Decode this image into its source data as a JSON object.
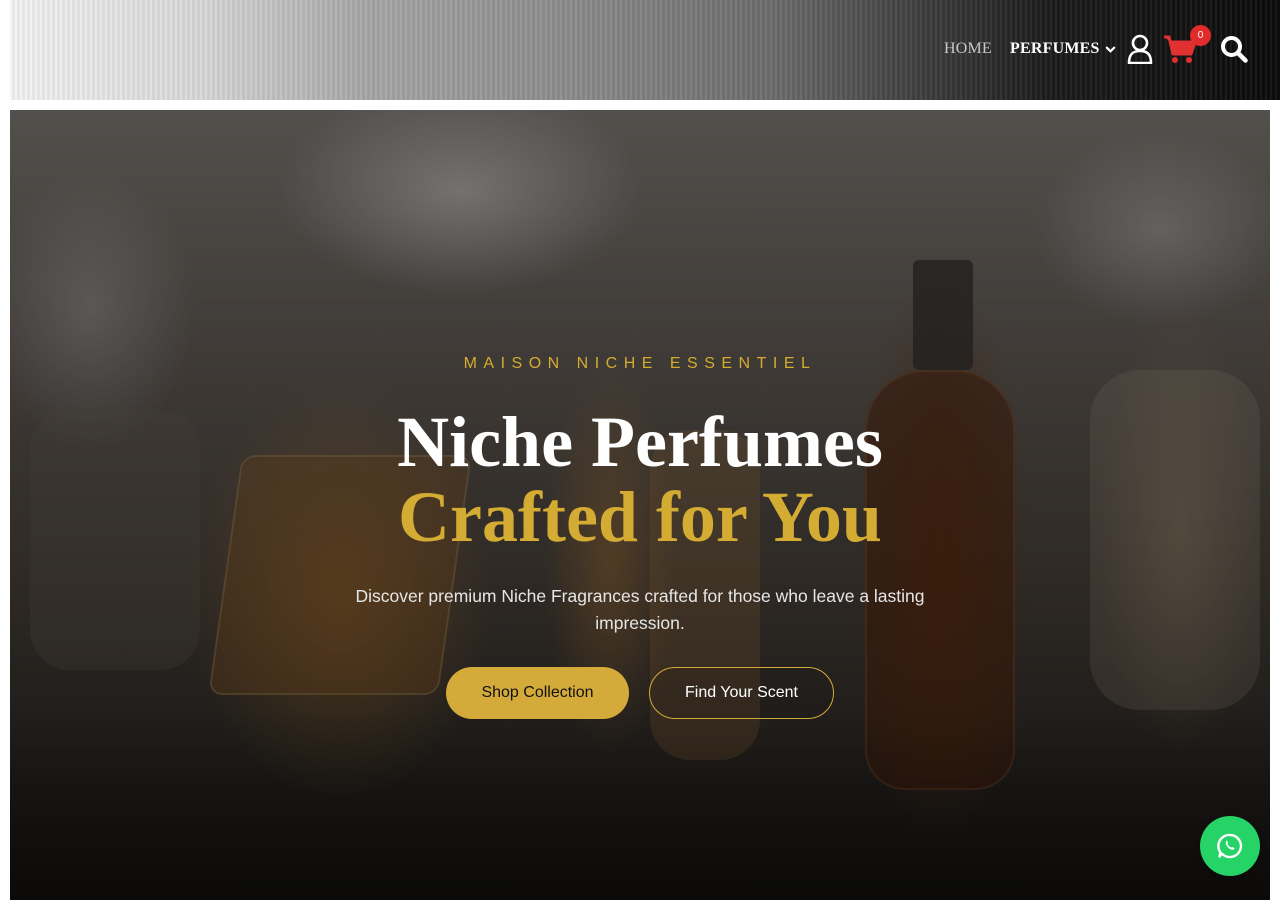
{
  "header": {
    "nav": {
      "home_label": "HOME",
      "perfumes_label": "PERFUMES"
    },
    "cart_count": "0",
    "icons": [
      "user-icon",
      "cart-icon",
      "search-icon",
      "chevron-down-icon"
    ],
    "colors": {
      "cart_badge": "#e22b2b",
      "cart_icon": "#e03030"
    }
  },
  "hero": {
    "eyebrow": "MAISON NICHE ESSENTIEL",
    "title_line_1": "Niche Perfumes",
    "title_line_2": "Crafted for You",
    "subtitle": "Discover premium Niche Fragrances crafted for those who leave a lasting impression.",
    "primary_button": "Shop Collection",
    "secondary_button": "Find Your Scent",
    "colors": {
      "accent_gold": "#d4ab33",
      "title_white": "#ffffff"
    }
  },
  "floating": {
    "icon": "whatsapp-icon",
    "color": "#25d366"
  }
}
